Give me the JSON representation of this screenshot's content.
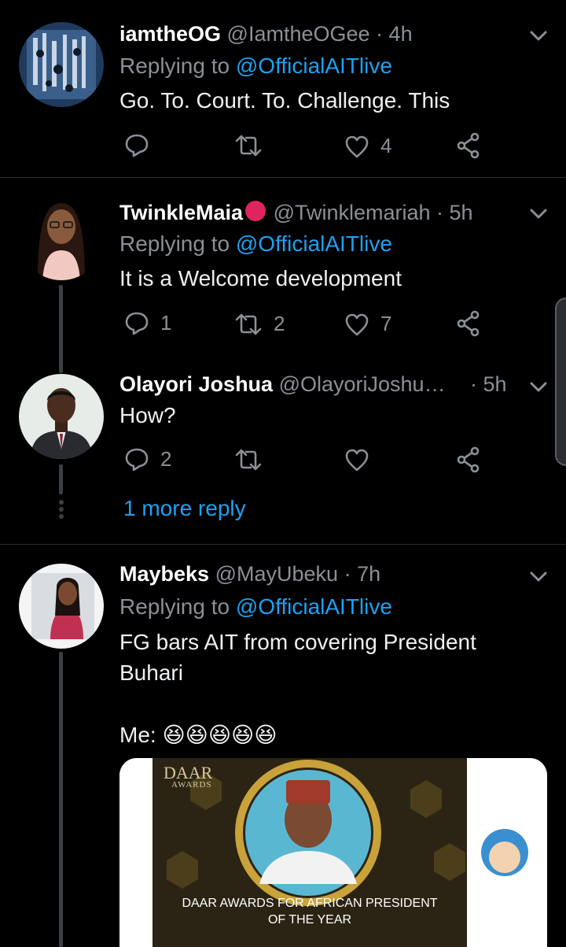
{
  "tweets": [
    {
      "display_name": "iamtheOG",
      "handle": "@IamtheOGee",
      "time": "· 4h",
      "replying_prefix": "Replying to",
      "replying_handle": "@OfficialAITlive",
      "text": "Go. To. Court. To. Challenge. This",
      "reply_count": "",
      "retweet_count": "",
      "like_count": "4"
    },
    {
      "display_name": "TwinkleMaia",
      "handle": "@Twinklemariah",
      "time": "· 5h",
      "replying_prefix": "Replying to",
      "replying_handle": "@OfficialAITlive",
      "text": "It is a Welcome development",
      "reply_count": "1",
      "retweet_count": "2",
      "like_count": "7"
    },
    {
      "display_name": "Olayori Joshua",
      "handle": "@OlayoriJoshu…",
      "time": "· 5h",
      "text": "How?",
      "reply_count": "2",
      "retweet_count": "",
      "like_count": ""
    },
    {
      "display_name": "Maybeks",
      "handle": "@MayUbeku",
      "time": "· 7h",
      "replying_prefix": "Replying to",
      "replying_handle": "@OfficialAITlive",
      "text_line1": "FG bars AIT from covering President",
      "text_line2": "Buhari",
      "text_line3": "Me:",
      "emojis": "😆😆😆😆😆"
    }
  ],
  "more_replies": "1 more reply",
  "media_card": {
    "logo_line1": "DAAR",
    "logo_line2": "AWARDS",
    "caption_line1": "DAAR AWARDS FOR AFRICAN PRESIDENT",
    "caption_line2": "OF THE YEAR"
  },
  "colors": {
    "background": "#000000",
    "link": "#1da1f2",
    "muted": "#8a9096",
    "status_dot": "#e0245e"
  }
}
